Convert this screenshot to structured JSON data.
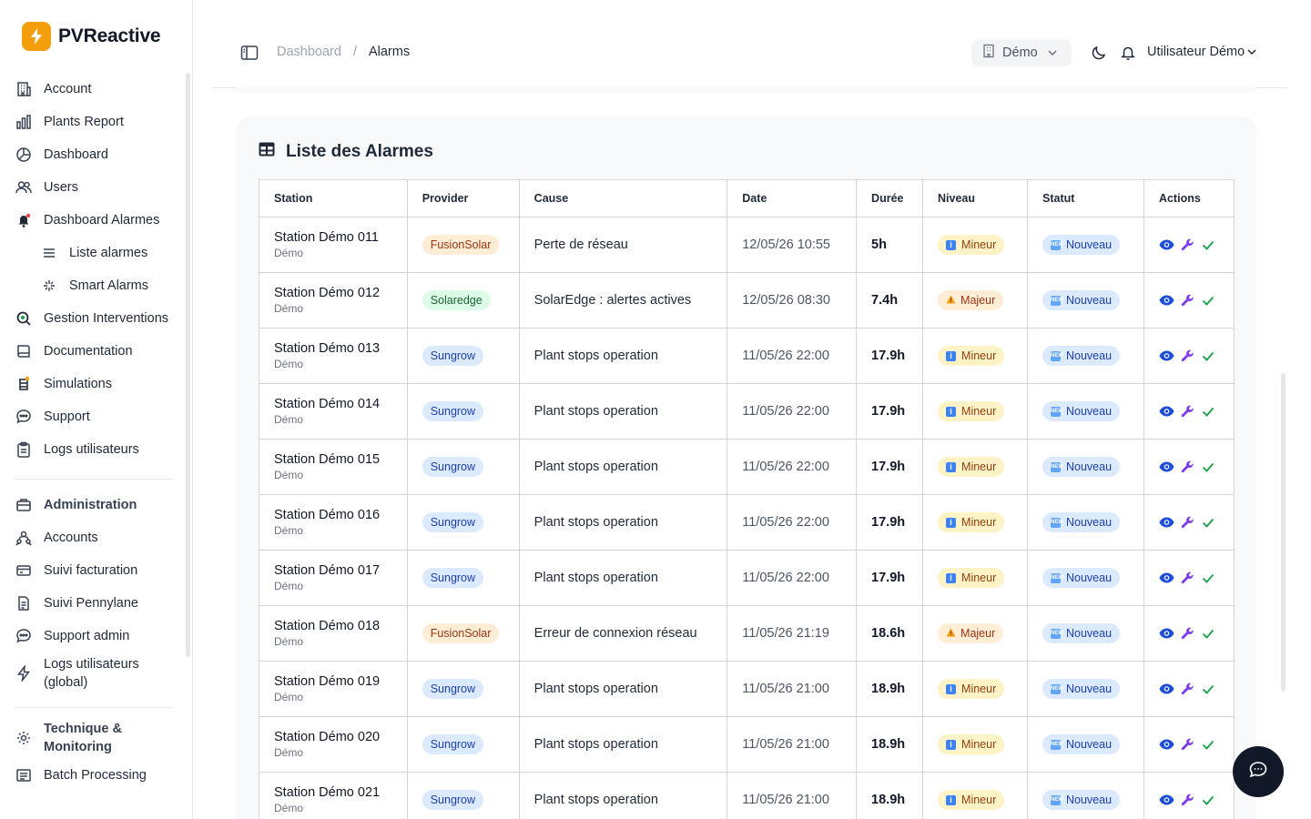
{
  "brand": {
    "name": "PVReactive"
  },
  "sidebar": {
    "items": [
      {
        "label": "Account",
        "icon": "building-icon"
      },
      {
        "label": "Plants Report",
        "icon": "bar-chart-icon"
      },
      {
        "label": "Dashboard",
        "icon": "pie-chart-icon"
      },
      {
        "label": "Users",
        "icon": "users-icon"
      },
      {
        "label": "Dashboard Alarmes",
        "icon": "bell-alert-icon"
      },
      {
        "label": "Liste alarmes",
        "icon": "list-icon"
      },
      {
        "label": "Smart Alarms",
        "icon": "sparkles-icon"
      },
      {
        "label": "Gestion Interventions",
        "icon": "search-icon"
      },
      {
        "label": "Documentation",
        "icon": "book-icon"
      },
      {
        "label": "Simulations",
        "icon": "flask-icon"
      },
      {
        "label": "Support",
        "icon": "chat-icon"
      },
      {
        "label": "Logs utilisateurs",
        "icon": "clipboard-icon"
      }
    ],
    "admin": [
      {
        "label": "Administration",
        "icon": "briefcase-icon"
      },
      {
        "label": "Accounts",
        "icon": "accounts-icon"
      },
      {
        "label": "Suivi facturation",
        "icon": "credit-card-icon"
      },
      {
        "label": "Suivi Pennylane",
        "icon": "document-icon"
      },
      {
        "label": "Support admin",
        "icon": "chat-icon"
      },
      {
        "label": "Logs utilisateurs (global)",
        "icon": "bolt-icon"
      }
    ],
    "technique": [
      {
        "label": "Technique & Monitoring",
        "icon": "gear-icon"
      },
      {
        "label": "Batch Processing",
        "icon": "batch-icon"
      }
    ]
  },
  "header": {
    "breadcrumb": {
      "parent": "Dashboard",
      "separator": "/",
      "current": "Alarms"
    },
    "org_select": "Démo",
    "user": "Utilisateur Démo"
  },
  "card": {
    "title": "Liste des Alarmes",
    "columns": [
      "Station",
      "Provider",
      "Cause",
      "Date",
      "Durée",
      "Niveau",
      "Statut",
      "Actions"
    ]
  },
  "rows": [
    {
      "station": "Station Démo 011",
      "org": "Démo",
      "provider": "FusionSolar",
      "cause": "Perte de réseau",
      "date": "12/05/26 10:55",
      "duration": "5h",
      "level": "Mineur",
      "status": "Nouveau"
    },
    {
      "station": "Station Démo 012",
      "org": "Démo",
      "provider": "Solaredge",
      "cause": "SolarEdge : alertes actives",
      "date": "12/05/26 08:30",
      "duration": "7.4h",
      "level": "Majeur",
      "status": "Nouveau"
    },
    {
      "station": "Station Démo 013",
      "org": "Démo",
      "provider": "Sungrow",
      "cause": "Plant stops operation",
      "date": "11/05/26 22:00",
      "duration": "17.9h",
      "level": "Mineur",
      "status": "Nouveau"
    },
    {
      "station": "Station Démo 014",
      "org": "Démo",
      "provider": "Sungrow",
      "cause": "Plant stops operation",
      "date": "11/05/26 22:00",
      "duration": "17.9h",
      "level": "Mineur",
      "status": "Nouveau"
    },
    {
      "station": "Station Démo 015",
      "org": "Démo",
      "provider": "Sungrow",
      "cause": "Plant stops operation",
      "date": "11/05/26 22:00",
      "duration": "17.9h",
      "level": "Mineur",
      "status": "Nouveau"
    },
    {
      "station": "Station Démo 016",
      "org": "Démo",
      "provider": "Sungrow",
      "cause": "Plant stops operation",
      "date": "11/05/26 22:00",
      "duration": "17.9h",
      "level": "Mineur",
      "status": "Nouveau"
    },
    {
      "station": "Station Démo 017",
      "org": "Démo",
      "provider": "Sungrow",
      "cause": "Plant stops operation",
      "date": "11/05/26 22:00",
      "duration": "17.9h",
      "level": "Mineur",
      "status": "Nouveau"
    },
    {
      "station": "Station Démo 018",
      "org": "Démo",
      "provider": "FusionSolar",
      "cause": "Erreur de connexion réseau",
      "date": "11/05/26 21:19",
      "duration": "18.6h",
      "level": "Majeur",
      "status": "Nouveau"
    },
    {
      "station": "Station Démo 019",
      "org": "Démo",
      "provider": "Sungrow",
      "cause": "Plant stops operation",
      "date": "11/05/26 21:00",
      "duration": "18.9h",
      "level": "Mineur",
      "status": "Nouveau"
    },
    {
      "station": "Station Démo 020",
      "org": "Démo",
      "provider": "Sungrow",
      "cause": "Plant stops operation",
      "date": "11/05/26 21:00",
      "duration": "18.9h",
      "level": "Mineur",
      "status": "Nouveau"
    },
    {
      "station": "Station Démo 021",
      "org": "Démo",
      "provider": "Sungrow",
      "cause": "Plant stops operation",
      "date": "11/05/26 21:00",
      "duration": "18.9h",
      "level": "Mineur",
      "status": "Nouveau"
    }
  ],
  "colors": {
    "brand": "#f59e0b",
    "action_view": "#1d4ed8",
    "action_fix": "#7c3aed",
    "action_ack": "#16a34a"
  }
}
